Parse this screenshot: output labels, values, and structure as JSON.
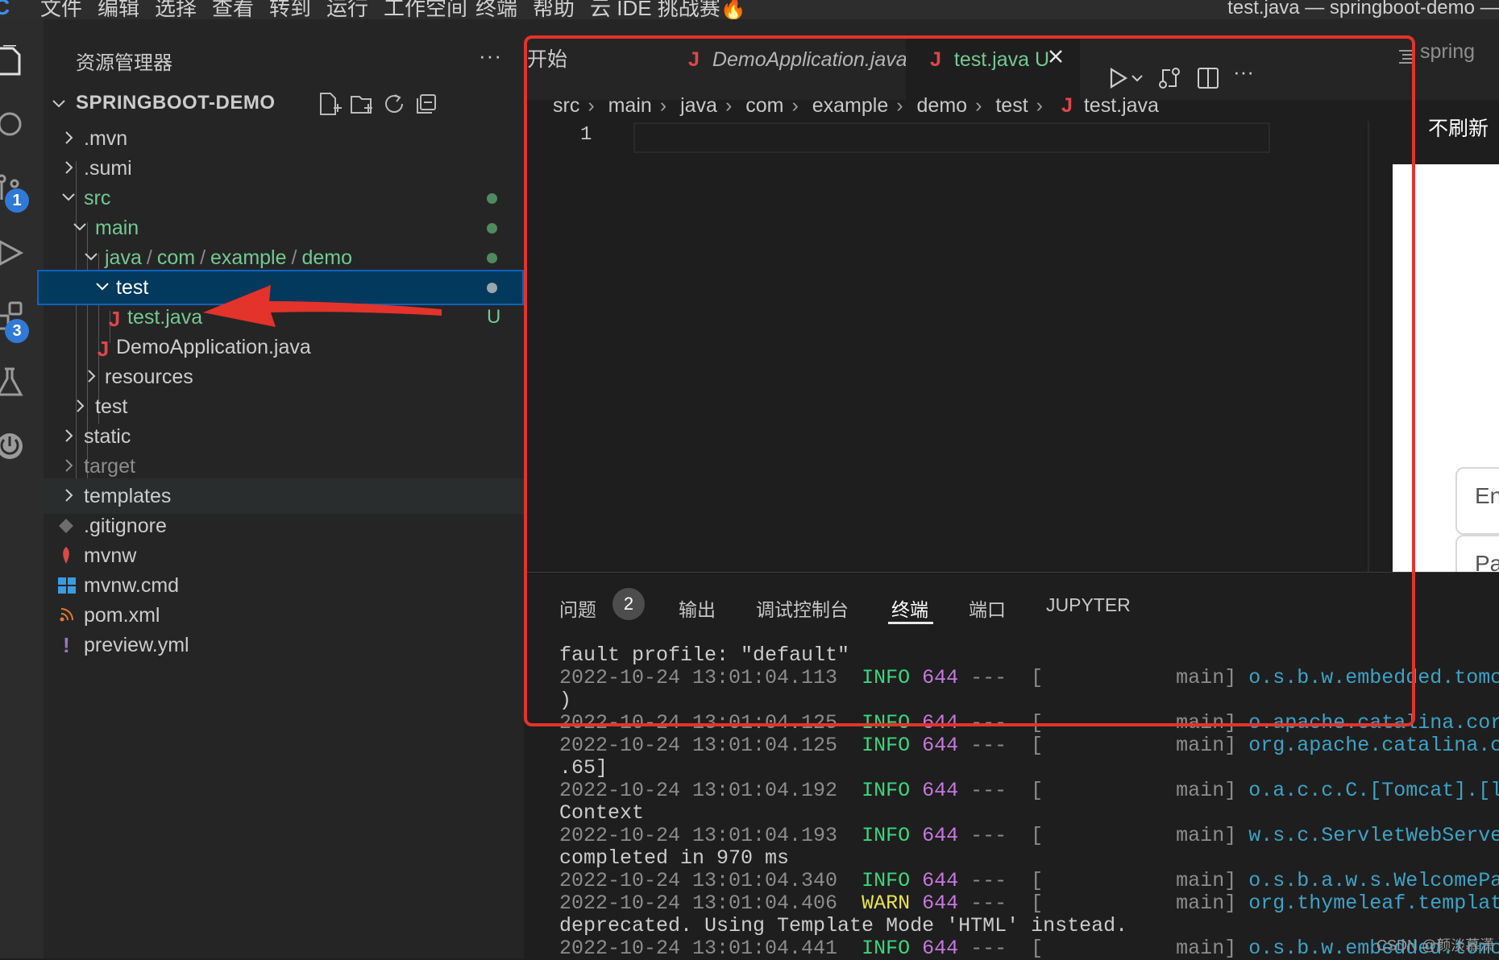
{
  "menubar": {
    "logo": "C",
    "items": [
      "文件",
      "编辑",
      "选择",
      "查看",
      "转到",
      "运行",
      "工作空间",
      "终端",
      "帮助",
      "云 IDE 挑战赛🔥"
    ],
    "window_title": "test.java — springboot-demo — Cl"
  },
  "activitybar": {
    "icons": [
      "explorer-icon",
      "search-icon",
      "source-control-icon",
      "run-debug-icon",
      "extensions-icon",
      "testing-icon",
      "power-icon"
    ],
    "badges": {
      "source_control": "1",
      "extensions": "3"
    }
  },
  "sidebar": {
    "title": "资源管理器",
    "more": "···",
    "project": "SPRINGBOOT-DEMO",
    "tree": {
      "mvn": ".mvn",
      "sumi": ".sumi",
      "src": "src",
      "main": "main",
      "java_path": [
        "java",
        "com",
        "example",
        "demo"
      ],
      "test_folder": "test",
      "test_java": "test.java",
      "test_java_status": "U",
      "demo_app": "DemoApplication.java",
      "resources": "resources",
      "test_root": "test",
      "static": "static",
      "target": "target",
      "templates": "templates",
      "gitignore": ".gitignore",
      "mvnw": "mvnw",
      "mvnw_cmd": "mvnw.cmd",
      "pom": "pom.xml",
      "preview": "preview.yml"
    }
  },
  "editor": {
    "tabs": {
      "start": "开始",
      "demo": "DemoApplication.java",
      "test": "test.java",
      "test_status": "U",
      "java_glyph": "J"
    },
    "breadcrumb": [
      "src",
      "main",
      "java",
      "com",
      "example",
      "demo",
      "test",
      "test.java"
    ],
    "line_number": "1"
  },
  "preview": {
    "tab_label": "spring",
    "refresh_label": "不刷新",
    "input1": "En",
    "input2": "Pa"
  },
  "panel": {
    "tabs": {
      "problems": "问题",
      "problems_count": "2",
      "output": "输出",
      "debug_console": "调试控制台",
      "terminal": "终端",
      "ports": "端口",
      "jupyter": "JUPYTER"
    },
    "terminal": {
      "l1": "fault profile: \"default\"",
      "l2": {
        "ts": "2022-10-24 13:01:04.113",
        "lvl": "INFO",
        "pid": "644",
        "thread": "---  [           main]",
        "logger": "o.s.b.w.embedded.tomcat.T"
      },
      "l3": ")",
      "l4": {
        "ts": "2022-10-24 13:01:04.125",
        "lvl": "INFO",
        "pid": "644",
        "thread": "---  [           main]",
        "logger": "o.apache.catalina.core.St"
      },
      "l5": {
        "ts": "2022-10-24 13:01:04.125",
        "lvl": "INFO",
        "pid": "644",
        "thread": "---  [           main]",
        "logger": "org.apache.catalina.core."
      },
      "l6": ".65]",
      "l7": {
        "ts": "2022-10-24 13:01:04.192",
        "lvl": "INFO",
        "pid": "644",
        "thread": "---  [           main]",
        "logger": "o.a.c.c.C.[Tomcat].[local"
      },
      "l8": "Context",
      "l9": {
        "ts": "2022-10-24 13:01:04.193",
        "lvl": "INFO",
        "pid": "644",
        "thread": "---  [           main]",
        "logger": "w.s.c.ServletWebServerApp"
      },
      "l10": "completed in 970 ms",
      "l11": {
        "ts": "2022-10-24 13:01:04.340",
        "lvl": "INFO",
        "pid": "644",
        "thread": "---  [           main]",
        "logger": "o.s.b.a.w.s.WelcomePageHa"
      },
      "l12": {
        "ts": "2022-10-24 13:01:04.406",
        "lvl": "WARN",
        "pid": "644",
        "thread": "---  [           main]",
        "logger": "org.thymeleaf.templatemod"
      },
      "l13": "deprecated. Using Template Mode 'HTML' instead.",
      "l14": {
        "ts": "2022-10-24 13:01:04.441",
        "lvl": "INFO",
        "pid": "644",
        "thread": "---  [           main]",
        "logger": "o.s.b.w.embedded.tomcat.T"
      }
    }
  },
  "watermark": "CSDN @颜淡慕潇",
  "colors": {
    "annotation_red": "#e3332a",
    "selection": "#04395e",
    "untracked_green": "#73c991",
    "java_icon_red": "#e0464a"
  }
}
